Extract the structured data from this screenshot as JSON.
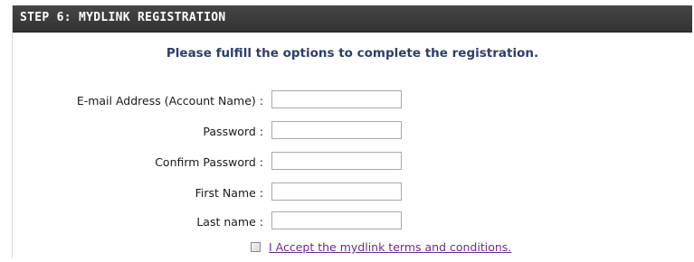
{
  "header": {
    "title": "STEP 6: MYDLINK REGISTRATION"
  },
  "instruction": "Please fulfill the options to complete the registration.",
  "form": {
    "email": {
      "label": "E-mail Address (Account Name) :",
      "value": ""
    },
    "password": {
      "label": "Password :",
      "value": ""
    },
    "confirm_password": {
      "label": "Confirm Password :",
      "value": ""
    },
    "first_name": {
      "label": "First Name :",
      "value": ""
    },
    "last_name": {
      "label": "Last name :",
      "value": ""
    }
  },
  "accept": {
    "checked": false,
    "link_text": "I Accept the mydlink terms and conditions."
  },
  "colors": {
    "header_bg": "#3a3a3a",
    "header_text": "#ffffff",
    "instruction_text": "#2c3e6b",
    "link_text": "#6b2c8a"
  }
}
